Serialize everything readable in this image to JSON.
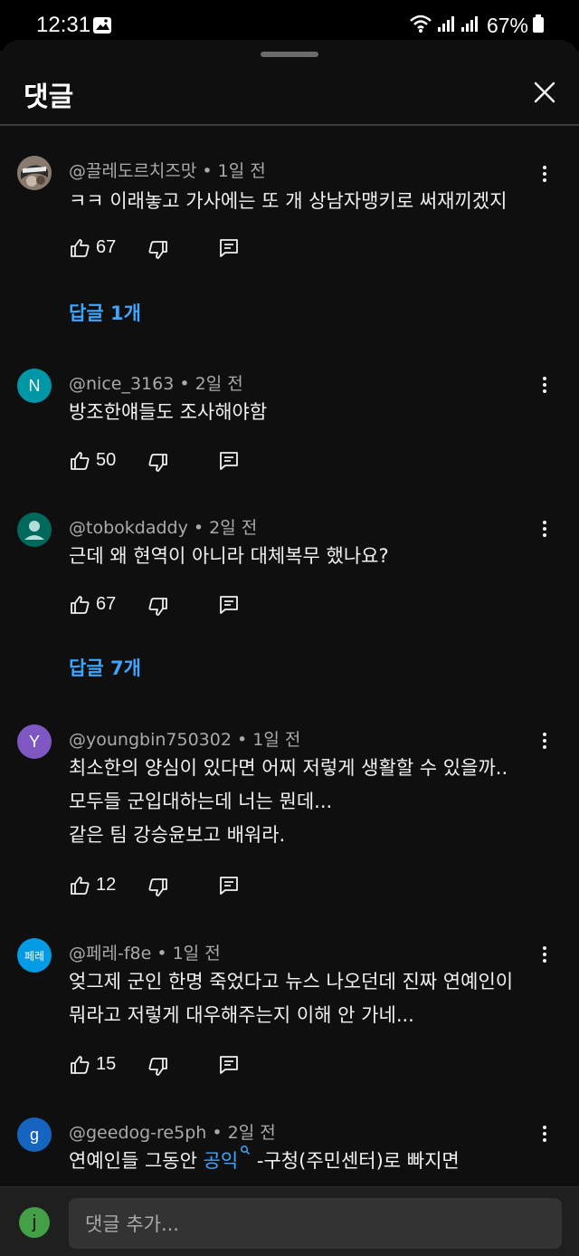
{
  "status": {
    "time": "12:31",
    "battery": "67%"
  },
  "sheet": {
    "title": "댓글"
  },
  "comments": [
    {
      "handle": "@끌레도르치즈맛",
      "age": "1일 전",
      "lines": [
        "ㅋㅋ 이래놓고 가사에는 또 개 상남자맹키로 써재끼겠지"
      ],
      "likes": "67",
      "replies": "답글 1개"
    },
    {
      "handle": "@nice_3163",
      "age": "2일 전",
      "avatar_letter": "N",
      "avatar_color": "#0097a7",
      "lines": [
        "방조한얘들도 조사해야함"
      ],
      "likes": "50"
    },
    {
      "handle": "@tobokdaddy",
      "age": "2일 전",
      "avatar_color": "#00695c",
      "lines": [
        "근데 왜 현역이 아니라 대체복무 했나요?"
      ],
      "likes": "67",
      "replies": "답글 7개"
    },
    {
      "handle": "@youngbin750302",
      "age": "1일 전",
      "avatar_letter": "Y",
      "avatar_color": "#7e57c2",
      "lines": [
        "최소한의 양심이 있다면 어찌 저렇게 생활할 수 있을까..",
        "모두들 군입대하는데 너는 뭔데...",
        "같은 팀 강승윤보고 배워라."
      ],
      "likes": "12"
    },
    {
      "handle": "@페레-f8e",
      "age": "1일 전",
      "avatar_letter": "페레",
      "avatar_color": "#039be5",
      "lines": [
        "엊그제 군인 한명 죽었다고 뉴스 나오던데 진짜 연예인이",
        "뭐라고 저렇게 대우해주는지 이해 안 가네..."
      ],
      "likes": "15"
    },
    {
      "handle": "@geedog-re5ph",
      "age": "2일 전",
      "avatar_letter": "g",
      "avatar_color": "#1565c0",
      "line_prefix": "연예인들 그동안 ",
      "line_link": "공익",
      "line_suffix": " -구청(주민센터)로 빠지면"
    }
  ],
  "input": {
    "avatar_letter": "j",
    "placeholder": "댓글 추가..."
  }
}
